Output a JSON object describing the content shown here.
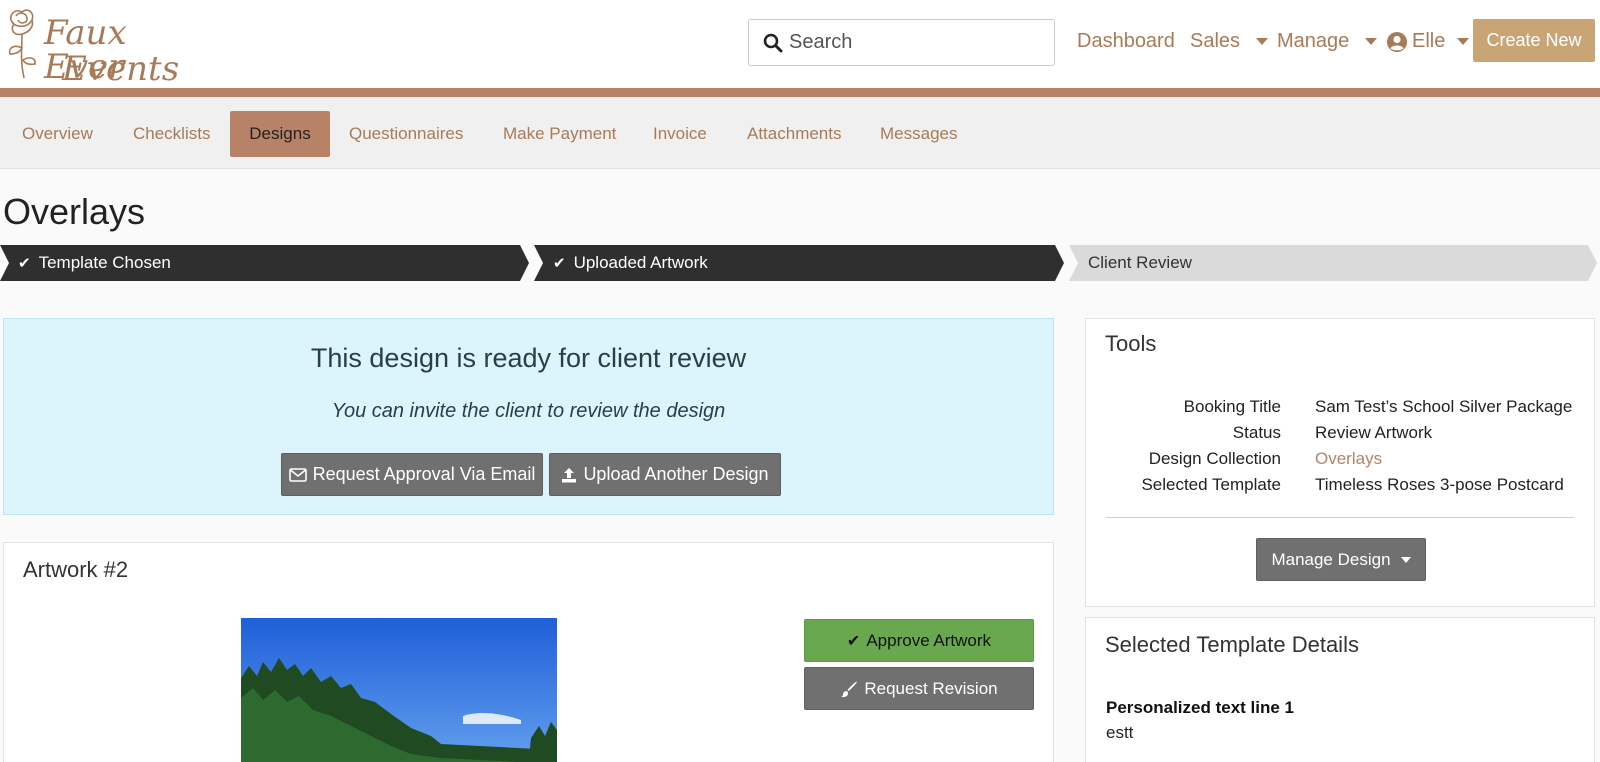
{
  "brand": {
    "line1": "Faux Ever",
    "line2": "Events"
  },
  "search": {
    "placeholder": "Search"
  },
  "topnav": {
    "dashboard": "Dashboard",
    "sales": "Sales",
    "manage": "Manage",
    "user": "Elle",
    "create_new": "Create New"
  },
  "tabs": [
    {
      "label": "Overview"
    },
    {
      "label": "Checklists"
    },
    {
      "label": "Designs"
    },
    {
      "label": "Questionnaires"
    },
    {
      "label": "Make Payment"
    },
    {
      "label": "Invoice"
    },
    {
      "label": "Attachments"
    },
    {
      "label": "Messages"
    }
  ],
  "active_tab": "Designs",
  "page_title": "Overlays",
  "steps": [
    {
      "label": "Template Chosen",
      "done": true
    },
    {
      "label": "Uploaded Artwork",
      "done": true
    },
    {
      "label": "Client Review",
      "done": false
    }
  ],
  "review_alert": {
    "title": "This design is ready for client review",
    "subtitle": "You can invite the client to review the design",
    "request_email": "Request Approval Via Email",
    "upload_another": "Upload Another Design"
  },
  "artwork": {
    "title": "Artwork #2",
    "approve": "Approve Artwork",
    "request_revision": "Request Revision"
  },
  "tools": {
    "title": "Tools",
    "rows": [
      {
        "label": "Booking Title",
        "value": "Sam Test’s School Silver Package"
      },
      {
        "label": "Status",
        "value": "Review Artwork"
      },
      {
        "label": "Design Collection",
        "value": "Overlays"
      },
      {
        "label": "Selected Template",
        "value": "Timeless Roses 3-pose Postcard"
      }
    ],
    "manage_design": "Manage Design"
  },
  "template_details": {
    "title": "Selected Template Details",
    "field_label": "Personalized text line 1",
    "field_value": "estt"
  },
  "colors": {
    "brand": "#a87b58",
    "accent": "#b88266",
    "create_button": "#c9a576",
    "step_done": "#2f2f2f",
    "alert_bg": "#dcf4fb",
    "approve_green": "#6aa84f"
  },
  "icons": [
    "rose-logo",
    "search-icon",
    "user-circle-icon",
    "check-icon",
    "envelope-icon",
    "upload-icon",
    "brush-icon",
    "caret-down-icon"
  ]
}
